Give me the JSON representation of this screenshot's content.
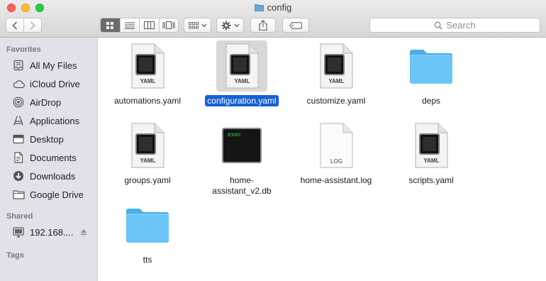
{
  "window": {
    "title": "config"
  },
  "search": {
    "placeholder": "Search"
  },
  "sidebar": {
    "favorites_header": "Favorites",
    "favorites": [
      {
        "label": "All My Files",
        "icon": "all-files-icon"
      },
      {
        "label": "iCloud Drive",
        "icon": "cloud-icon"
      },
      {
        "label": "AirDrop",
        "icon": "airdrop-icon"
      },
      {
        "label": "Applications",
        "icon": "applications-icon"
      },
      {
        "label": "Desktop",
        "icon": "desktop-icon"
      },
      {
        "label": "Documents",
        "icon": "documents-icon"
      },
      {
        "label": "Downloads",
        "icon": "downloads-icon"
      },
      {
        "label": "Google Drive",
        "icon": "folder-icon"
      }
    ],
    "shared_header": "Shared",
    "shared": [
      {
        "label": "192.168....",
        "icon": "monitor-icon"
      }
    ],
    "tags_header": "Tags"
  },
  "files": [
    {
      "name": "automations.yaml",
      "icon": "yaml-file-icon",
      "badge": "YAML"
    },
    {
      "name": "configuration.yaml",
      "icon": "yaml-file-icon",
      "badge": "YAML",
      "selected": true
    },
    {
      "name": "customize.yaml",
      "icon": "yaml-file-icon",
      "badge": "YAML"
    },
    {
      "name": "deps",
      "icon": "folder-icon"
    },
    {
      "name": "groups.yaml",
      "icon": "yaml-file-icon",
      "badge": "YAML"
    },
    {
      "name_line1": "home-",
      "name_line2": "assistant_v2.db",
      "icon": "exec-file-icon",
      "badge": "exec"
    },
    {
      "name": "home-assistant.log",
      "icon": "log-file-icon",
      "badge": "LOG"
    },
    {
      "name": "scripts.yaml",
      "icon": "yaml-file-icon",
      "badge": "YAML"
    },
    {
      "name": "tts",
      "icon": "folder-icon"
    }
  ],
  "colors": {
    "selection": "#1560d7",
    "folder": "#5ebcf4",
    "sidebar_bg": "#e4e0e9"
  }
}
